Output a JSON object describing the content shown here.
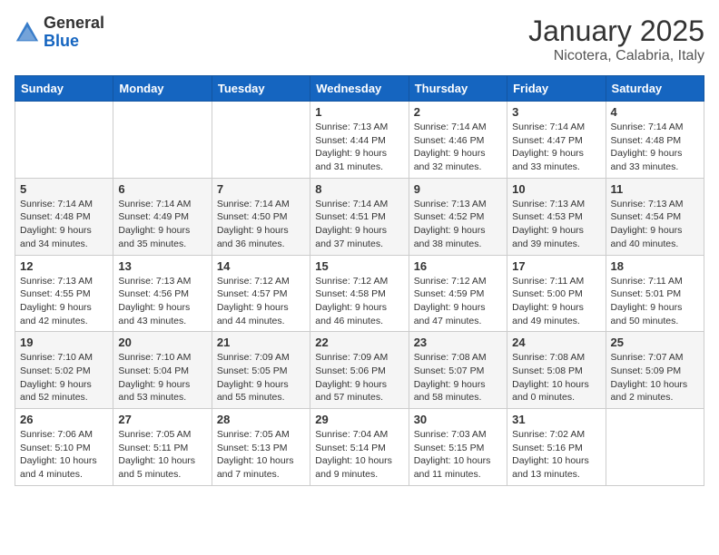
{
  "header": {
    "logo_general": "General",
    "logo_blue": "Blue",
    "month_title": "January 2025",
    "location": "Nicotera, Calabria, Italy"
  },
  "columns": [
    "Sunday",
    "Monday",
    "Tuesday",
    "Wednesday",
    "Thursday",
    "Friday",
    "Saturday"
  ],
  "weeks": [
    {
      "days": [
        {
          "date": "",
          "info": ""
        },
        {
          "date": "",
          "info": ""
        },
        {
          "date": "",
          "info": ""
        },
        {
          "date": "1",
          "info": "Sunrise: 7:13 AM\nSunset: 4:44 PM\nDaylight: 9 hours\nand 31 minutes."
        },
        {
          "date": "2",
          "info": "Sunrise: 7:14 AM\nSunset: 4:46 PM\nDaylight: 9 hours\nand 32 minutes."
        },
        {
          "date": "3",
          "info": "Sunrise: 7:14 AM\nSunset: 4:47 PM\nDaylight: 9 hours\nand 33 minutes."
        },
        {
          "date": "4",
          "info": "Sunrise: 7:14 AM\nSunset: 4:48 PM\nDaylight: 9 hours\nand 33 minutes."
        }
      ]
    },
    {
      "days": [
        {
          "date": "5",
          "info": "Sunrise: 7:14 AM\nSunset: 4:48 PM\nDaylight: 9 hours\nand 34 minutes."
        },
        {
          "date": "6",
          "info": "Sunrise: 7:14 AM\nSunset: 4:49 PM\nDaylight: 9 hours\nand 35 minutes."
        },
        {
          "date": "7",
          "info": "Sunrise: 7:14 AM\nSunset: 4:50 PM\nDaylight: 9 hours\nand 36 minutes."
        },
        {
          "date": "8",
          "info": "Sunrise: 7:14 AM\nSunset: 4:51 PM\nDaylight: 9 hours\nand 37 minutes."
        },
        {
          "date": "9",
          "info": "Sunrise: 7:13 AM\nSunset: 4:52 PM\nDaylight: 9 hours\nand 38 minutes."
        },
        {
          "date": "10",
          "info": "Sunrise: 7:13 AM\nSunset: 4:53 PM\nDaylight: 9 hours\nand 39 minutes."
        },
        {
          "date": "11",
          "info": "Sunrise: 7:13 AM\nSunset: 4:54 PM\nDaylight: 9 hours\nand 40 minutes."
        }
      ]
    },
    {
      "days": [
        {
          "date": "12",
          "info": "Sunrise: 7:13 AM\nSunset: 4:55 PM\nDaylight: 9 hours\nand 42 minutes."
        },
        {
          "date": "13",
          "info": "Sunrise: 7:13 AM\nSunset: 4:56 PM\nDaylight: 9 hours\nand 43 minutes."
        },
        {
          "date": "14",
          "info": "Sunrise: 7:12 AM\nSunset: 4:57 PM\nDaylight: 9 hours\nand 44 minutes."
        },
        {
          "date": "15",
          "info": "Sunrise: 7:12 AM\nSunset: 4:58 PM\nDaylight: 9 hours\nand 46 minutes."
        },
        {
          "date": "16",
          "info": "Sunrise: 7:12 AM\nSunset: 4:59 PM\nDaylight: 9 hours\nand 47 minutes."
        },
        {
          "date": "17",
          "info": "Sunrise: 7:11 AM\nSunset: 5:00 PM\nDaylight: 9 hours\nand 49 minutes."
        },
        {
          "date": "18",
          "info": "Sunrise: 7:11 AM\nSunset: 5:01 PM\nDaylight: 9 hours\nand 50 minutes."
        }
      ]
    },
    {
      "days": [
        {
          "date": "19",
          "info": "Sunrise: 7:10 AM\nSunset: 5:02 PM\nDaylight: 9 hours\nand 52 minutes."
        },
        {
          "date": "20",
          "info": "Sunrise: 7:10 AM\nSunset: 5:04 PM\nDaylight: 9 hours\nand 53 minutes."
        },
        {
          "date": "21",
          "info": "Sunrise: 7:09 AM\nSunset: 5:05 PM\nDaylight: 9 hours\nand 55 minutes."
        },
        {
          "date": "22",
          "info": "Sunrise: 7:09 AM\nSunset: 5:06 PM\nDaylight: 9 hours\nand 57 minutes."
        },
        {
          "date": "23",
          "info": "Sunrise: 7:08 AM\nSunset: 5:07 PM\nDaylight: 9 hours\nand 58 minutes."
        },
        {
          "date": "24",
          "info": "Sunrise: 7:08 AM\nSunset: 5:08 PM\nDaylight: 10 hours\nand 0 minutes."
        },
        {
          "date": "25",
          "info": "Sunrise: 7:07 AM\nSunset: 5:09 PM\nDaylight: 10 hours\nand 2 minutes."
        }
      ]
    },
    {
      "days": [
        {
          "date": "26",
          "info": "Sunrise: 7:06 AM\nSunset: 5:10 PM\nDaylight: 10 hours\nand 4 minutes."
        },
        {
          "date": "27",
          "info": "Sunrise: 7:05 AM\nSunset: 5:11 PM\nDaylight: 10 hours\nand 5 minutes."
        },
        {
          "date": "28",
          "info": "Sunrise: 7:05 AM\nSunset: 5:13 PM\nDaylight: 10 hours\nand 7 minutes."
        },
        {
          "date": "29",
          "info": "Sunrise: 7:04 AM\nSunset: 5:14 PM\nDaylight: 10 hours\nand 9 minutes."
        },
        {
          "date": "30",
          "info": "Sunrise: 7:03 AM\nSunset: 5:15 PM\nDaylight: 10 hours\nand 11 minutes."
        },
        {
          "date": "31",
          "info": "Sunrise: 7:02 AM\nSunset: 5:16 PM\nDaylight: 10 hours\nand 13 minutes."
        },
        {
          "date": "",
          "info": ""
        }
      ]
    }
  ]
}
